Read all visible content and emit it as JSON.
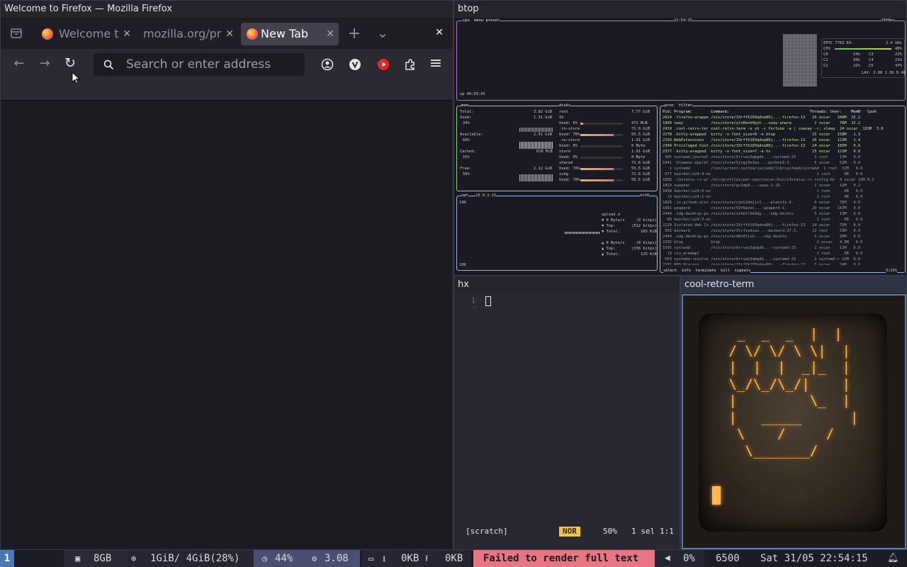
{
  "firefox": {
    "window_title": "Welcome to Firefox — Mozilla Firefox",
    "tabs": [
      {
        "label": "Welcome t",
        "active": false
      },
      {
        "label": "mozilla.org/pr",
        "active": false
      },
      {
        "label": "New Tab",
        "active": true
      }
    ],
    "tab_close": "✕",
    "new_tab": "+",
    "list_tabs": "⌄",
    "close_window": "✕",
    "back": "←",
    "forward": "→",
    "reload": "↻",
    "menu": "≡",
    "search_placeholder": "Search or enter address",
    "toolbar_icons": [
      "account-icon",
      "extension-v-icon",
      "youtube-icon",
      "extensions-puzzle-icon"
    ]
  },
  "btop": {
    "window_title": "btop",
    "cpu_header": "cpu  menu preset",
    "clock": "22:54:15",
    "refresh": "2000ms",
    "cpu_model": "EPYC 7763 64-",
    "freq": "2.4 GHz",
    "cpu_rows": [
      {
        "name": "CPU",
        "pct": "48%"
      },
      {
        "name": "C0",
        "pct": "54%",
        "name2": "C3",
        "pct2": "22%"
      },
      {
        "name": "C1",
        "pct": "99%",
        "name2": "C4",
        "pct2": "21%"
      },
      {
        "name": "C2",
        "pct": "22%",
        "name2": "C5",
        "pct2": "37%"
      }
    ],
    "load_avg": "LAV: 3.08 1.36 0.48",
    "uptime": "up 00:03:05",
    "mem": {
      "title": "mem",
      "rows": [
        {
          "label": "Total:",
          "value": "3.82 GiB"
        },
        {
          "label": "Used:",
          "value": "1.31 GiB",
          "pct": "34%"
        },
        {
          "label": "Available:",
          "value": "2.51 GiB",
          "pct": "66%"
        },
        {
          "label": "Cached:",
          "value": "616 MiB",
          "pct": "16%"
        },
        {
          "label": "Free:",
          "value": "2.12 GiB",
          "pct": "56%"
        }
      ]
    },
    "disks": {
      "title": "disks",
      "rows": [
        {
          "name": "root",
          "size": "7.77 GiB"
        },
        {
          "name": "IO",
          "size": ""
        },
        {
          "name": "Used: 6%",
          "size": "472 MiB"
        },
        {
          "name": ".ro-store",
          "size": "71.6 GiB"
        },
        {
          "name": "Used: 78%",
          "size": "55.5 GiB"
        },
        {
          "name": ".rw-store",
          "size": "1.91 GiB"
        },
        {
          "name": "Used: 0%",
          "size": "0 Byte"
        },
        {
          "name": "store",
          "size": "1.91 GiB"
        },
        {
          "name": "Used: 0%",
          "size": "0 Byte"
        },
        {
          "name": "shared",
          "size": "71.6 GiB"
        },
        {
          "name": "Used: 78%",
          "size": "55.5 GiB"
        },
        {
          "name": "xchg",
          "size": "71.6 GiB"
        },
        {
          "name": "Used: 78%",
          "size": "55.5 GiB"
        }
      ]
    },
    "net": {
      "title": "net",
      "ip": "10.0.2.15",
      "iface": "eth0",
      "scale_top": "10K",
      "scale_bottom": "10K",
      "rows": [
        "upload d",
        "▼ 0 Byte/s     (0 bitps)",
        "▼ Top:       (512 bitps)",
        "▼ Total:         165 KiB",
        "▲ 0 Byte/s     (0 bitps)",
        "▲ Top:       (336 bitps)",
        "▲ Total:         125 KiB"
      ]
    },
    "proc": {
      "title": "proc  filter",
      "header": "Pid: Program:        Command:                                   Threads: User:    MemB   Cpu%",
      "rows": [
        "2624 .firefox-wrappe /nix/store/33rffk103qdna80j...-firefox-13   26 oscar   348M  15.2",
        "1809 sway            /nix/store/yln6bnkHyyt...sway-unwra          2 oscar    76M  15.2",
        "2419 .cool-retro-ter cool-retro-term -e sh -c fortune -a | cowsay -r; sleep  24 oscar  163M  3.0",
        "2278 .kitty-wrapped  kitty -o font_size=8 -e btop                15 oscar   158M   1.3",
        "2156 WebExtensions   /nix/store/33rffk103qdna80j...-firefox-13   26 oscar   123M   1.4",
        "2304 Privileged Cont /nix/store/33rffk103qdna80j...-firefox-13   24 oscar   185M   0.6",
        "2377 .kitty-wrapped  kitty -o font_size=7 -e hx                  15 oscar   121M   0.0",
        " 405 systemd-journal /nix/store/6rrvaz3qbgdb...-systemd-25        1 root     13M   0.0",
        "1841 .blueman-applet /nix/store/5jvgj3n3yn...-python3-3.          5 oscar    52M   0.0",
        "   1 systemd         /run/current-system/systemd/lib/systemd/systemd  1 root  12M   0.0",
        " 677 kworker/u24:4-ev                                              1 root      0B   0.0",
        "1856 .i3status-rs-wr /etc/profiles/per-user/oscar/bin/i3status-rs config-bo  4 oscar 16M 0.1",
        "1823 swaybar         /nix/store/gc2mp8...-sway-1.10.              2 oscar    12M   0.2",
        "1058 kworker/u24:6-ev                                              1 root      0B   0.0",
        "  13 kworker/u24:1-ev                                              1 root      0B   0.0",
        "1826 .io.github.alai /nix/store/cjmlibmjic1...-planify-4.         6 oscar    76M   0.0",
        "1851 wpaperd         /nix/store/5Vf6asoc...-wpaperd-1.           20 oscar   147M   0.0",
        "2444 .xdg-desktop-po /nix/store/vi4efr3b3dy...-xdg-deskto         5 oscar    13M   0.0",
        "  60 kworker/u24:3-ev                                              1 root      0B   0.0",
        "2229 Isolated Web Co /nix/store/33rffk103qdna80j...-firefox-13   24 oscar    75M   0.0",
        " 953 dockerd         /nix/store/3lrfvxdiax...-dockerd-27.5.      12 root     53M   0.0",
        "2444 .xdg-desktop-po /nix/store/40v8fjvb...-xdg-deskto            5 oscar    20M   0.0",
        "2295 btop            btop                                          2 oscar   4.9M   0.0",
        "1695 systemd         /nix/store/6rrvaz3qbgdb...-systemd-25        1 oscar    11M   0.0",
        "  19 rcu_preempt                                                   1 root      0B   0.0",
        " 553 systemd-resolve /nix/store/6rrvaz3qbgdb...-systemd-25        1 systemd-r 12M  0.0",
        "2161 RDD Process     /nix/store/33rffk103qdna80j...-firefox-13    5 oscar    34M   0.0"
      ],
      "footer": "select  info  terminate  kill  signals",
      "count": "0/201"
    }
  },
  "hx": {
    "window_title": "hx",
    "line_number": "1",
    "tilde": "~",
    "buffer": "[scratch]",
    "mode": "NOR",
    "scroll": "50%",
    "selection": "1 sel",
    "position": "1:1"
  },
  "crt": {
    "window_title": "cool-retro-term",
    "art": "  _  _  _  |  |\n / \\/ \\/ \\ \\|  |\n |  |  |  _|_  |\n \\_/\\_/\\_/|    |\n |         \\_  |\n |   _____      |\n  \\    /     /\n   \\_______/\n"
  },
  "bar": {
    "workspace": "1",
    "ram": "8GB",
    "memory": "1GiB/ 4GiB(28%)",
    "cpu": "44%",
    "load": "3.08",
    "net_down": "0KB",
    "net_up": "0KB",
    "status_error": "Failed to render full text",
    "volume": "0%",
    "temperature": "6500",
    "datetime": "Sat 31/05 22:54:15",
    "colors": {
      "workspace_bg": "#4a78b8",
      "cpu_bg": "#4a4f72",
      "error_bg": "#e87582"
    }
  }
}
